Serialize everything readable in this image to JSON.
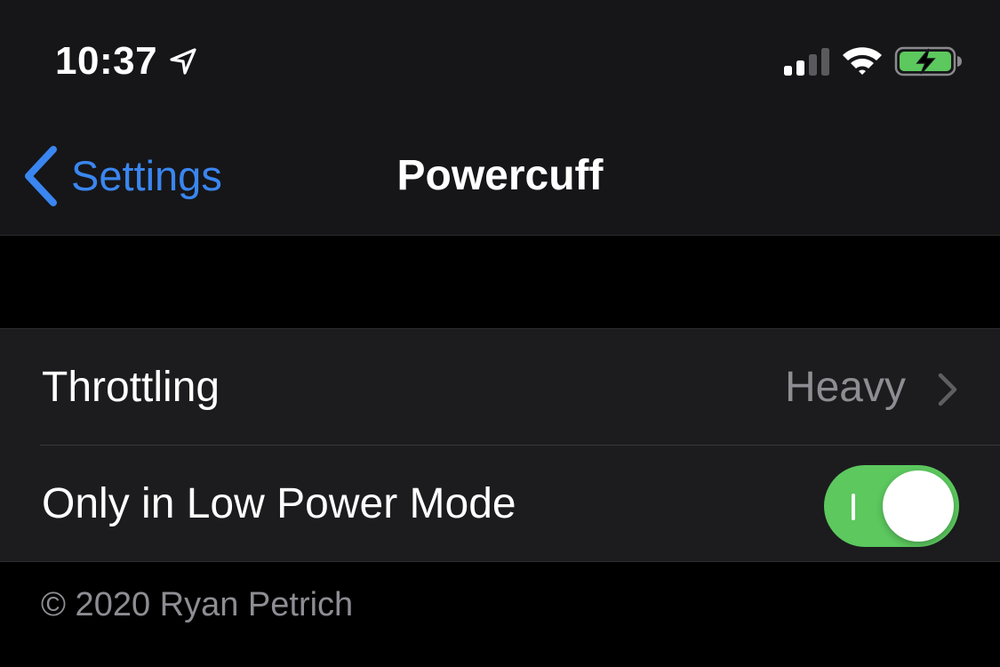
{
  "status_bar": {
    "time": "10:37",
    "location_icon": "location-arrow-icon",
    "signal_icon": "cellular-signal-icon",
    "wifi_icon": "wifi-icon",
    "battery_icon": "battery-charging-icon",
    "battery_color": "#5cc85e"
  },
  "nav": {
    "back_label": "Settings",
    "back_icon": "chevron-left-icon",
    "title": "Powercuff",
    "accent_color": "#3a86f0"
  },
  "settings": {
    "rows": [
      {
        "label": "Throttling",
        "value": "Heavy",
        "accessory_icon": "chevron-right-icon"
      },
      {
        "label": "Only in Low Power Mode",
        "toggle_on": true,
        "toggle_color": "#5cc85e"
      }
    ]
  },
  "footer": {
    "text": "© 2020 Ryan Petrich"
  }
}
